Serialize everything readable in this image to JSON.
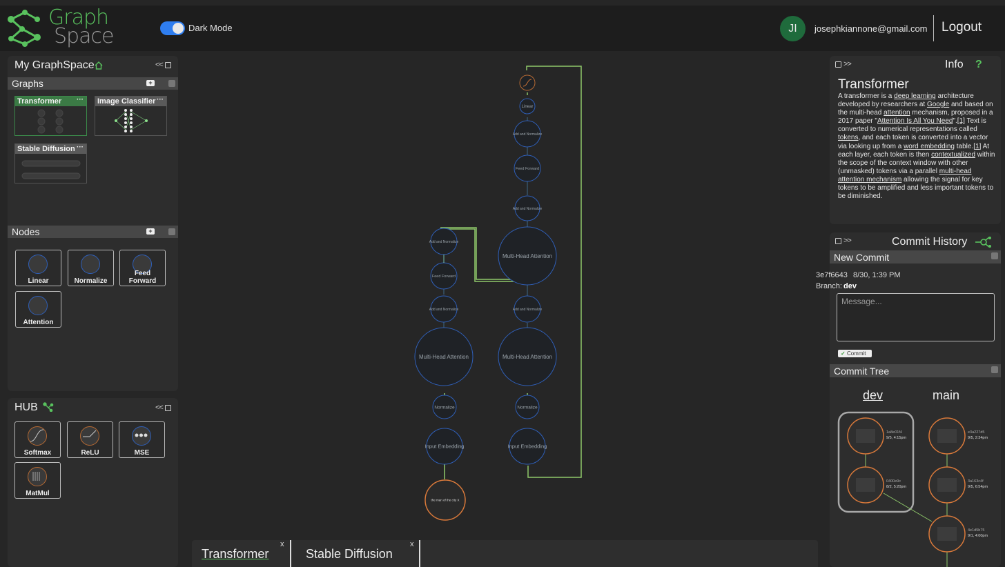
{
  "app": {
    "logo_line1": "Graph",
    "logo_line2": "Space",
    "dark_mode_label": "Dark Mode",
    "user_initials": "JI",
    "user_email": "josephkiannone@gmail.com",
    "logout_label": "Logout"
  },
  "left": {
    "title": "My GraphSpace",
    "collapse": "<<",
    "graphs_header": "Graphs",
    "graphs": [
      {
        "name": "Transformer",
        "menu": "···"
      },
      {
        "name": "Image Classifier",
        "menu": "···"
      },
      {
        "name": "Stable Diffusion",
        "menu": "···"
      }
    ],
    "nodes_header": "Nodes",
    "nodes": [
      {
        "name": "Linear"
      },
      {
        "name": "Normalize"
      },
      {
        "name": "Feed Forward"
      },
      {
        "name": "Attention"
      }
    ],
    "hub_title": "HUB",
    "hub": [
      {
        "name": "Softmax"
      },
      {
        "name": "ReLU"
      },
      {
        "name": "MSE"
      },
      {
        "name": "MatMul"
      }
    ]
  },
  "canvas": {
    "nodes": {
      "softmax": "",
      "linear": "Linear",
      "addnorm_top": "Add and Normalize",
      "ff_right": "Feed Forward",
      "addnorm_r2": "Add and Normalize",
      "mha_r1": "Multi-Head Attention",
      "addnorm_r3": "Add and Normalize",
      "mha_r2": "Multi-Head Attention",
      "norm_r": "Normalize",
      "emb_r": "Input Embedding",
      "addnorm_l1": "Add and Normalize",
      "ff_left": "Feed Forward",
      "addnorm_l2": "Add and Normalize",
      "mha_l": "Multi-Head Attention",
      "norm_l": "Normalize",
      "emb_l": "Input Embedding",
      "input": "the man of the city X"
    }
  },
  "info": {
    "collapse": ">>",
    "header": "Info",
    "help": "?",
    "title": "Transformer",
    "body": [
      {
        "t": "A transformer is a "
      },
      {
        "t": "deep learning",
        "u": true
      },
      {
        "t": " architecture developed by researchers at "
      },
      {
        "t": "Google",
        "u": true
      },
      {
        "t": " and based on the multi-head "
      },
      {
        "t": "attention",
        "u": true
      },
      {
        "t": " mechanism, proposed in a 2017 paper \""
      },
      {
        "t": "Attention Is All You Need",
        "u": true
      },
      {
        "t": "\"."
      },
      {
        "t": "[1]",
        "u": true
      },
      {
        "t": " Text is converted to numerical representations called "
      },
      {
        "t": "tokens",
        "u": true
      },
      {
        "t": ", and each token is converted into a vector via looking up from a "
      },
      {
        "t": "word embedding",
        "u": true
      },
      {
        "t": " table."
      },
      {
        "t": "[1]",
        "u": true
      },
      {
        "t": " At each layer, each token is then "
      },
      {
        "t": "contextualized",
        "u": true
      },
      {
        "t": " within the scope of the context window with other (unmasked) tokens via a parallel "
      },
      {
        "t": "multi-head",
        "u": true
      },
      {
        "t": " "
      },
      {
        "t": "attention mechanism",
        "u": true
      },
      {
        "t": " allowing the signal for key tokens to be amplified and less important tokens to be diminished."
      }
    ]
  },
  "commits": {
    "collapse": ">>",
    "header": "Commit History",
    "new_commit": "New Commit",
    "hash": "3e7f6643",
    "date": "8/30, 1:39 PM",
    "branch_label": "Branch:",
    "branch": "dev",
    "placeholder": "Message...",
    "commit_button": "Commit",
    "check": "✓",
    "tree_header": "Commit Tree",
    "branch_dev": "dev",
    "branch_main": "main",
    "dev_commits": [
      {
        "hash": "1a8e01f4",
        "date": "9/5, 4:15pm"
      },
      {
        "hash": "0400e9c",
        "date": "8/2, 5:20pm"
      }
    ],
    "main_commits": [
      {
        "hash": "e3a227d5",
        "date": "9/5, 2:34pm"
      },
      {
        "hash": "3a163c4f",
        "date": "9/5, 6:54pm"
      },
      {
        "hash": "4e1d5b75",
        "date": "9/1, 4:00pm"
      }
    ]
  },
  "tabs": [
    {
      "label": "Transformer",
      "close": "x"
    },
    {
      "label": "Stable Diffusion",
      "close": "x"
    }
  ],
  "colors": {
    "accent_green": "#59c25e",
    "toggle_blue": "#2f7ef0",
    "node_blue": "#2f5fb8",
    "node_orange": "#d9793a",
    "edge_green": "#8fc96a"
  }
}
